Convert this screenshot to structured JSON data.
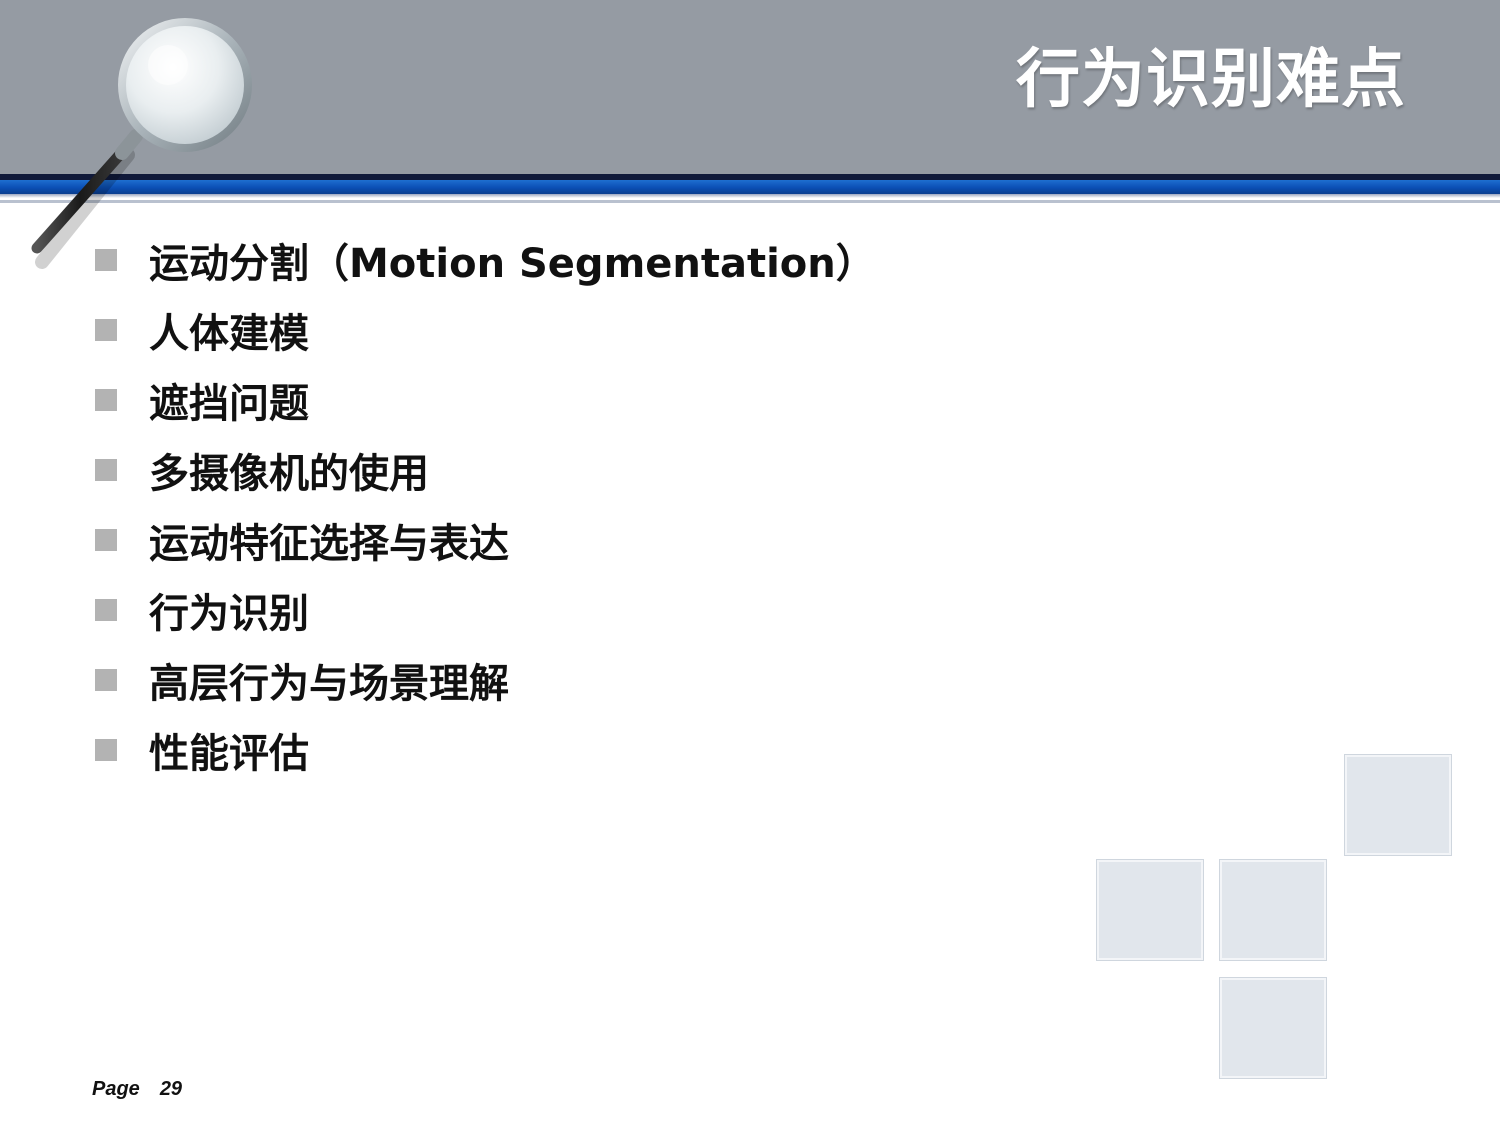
{
  "slide": {
    "title": "行为识别难点",
    "bullets": [
      "运动分割（Motion Segmentation）",
      "人体建模",
      "遮挡问题",
      "多摄像机的使用",
      "运动特征选择与表达",
      "行为识别",
      "高层行为与场景理解",
      "性能评估"
    ]
  },
  "footer": {
    "page_label": "Page",
    "page_number": "29"
  },
  "colors": {
    "header_band": "#959ba3",
    "accent_blue": "#0b4fb5",
    "bullet_marker": "#b3b3b3",
    "decor_square": "#e1e6ec"
  },
  "icons": {
    "logo": "magnifier-icon",
    "bullet": "square-bullet"
  }
}
